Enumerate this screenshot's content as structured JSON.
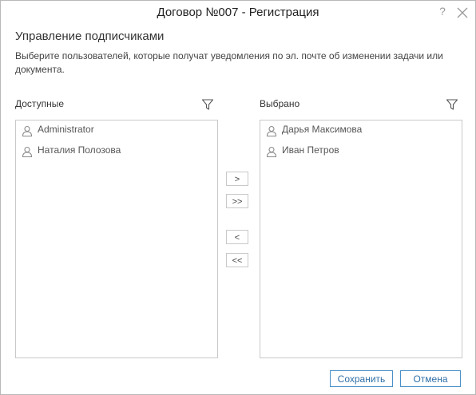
{
  "window": {
    "title": "Договор №007 - Регистрация",
    "help_label": "?"
  },
  "heading": "Управление подписчиками",
  "description": "Выберите пользователей, которые получат уведомления по эл. почте об изменении задачи или документа.",
  "available": {
    "label": "Доступные",
    "items": [
      "Administrator",
      "Наталия Полозова"
    ]
  },
  "selected": {
    "label": "Выбрано",
    "items": [
      "Дарья Максимова",
      "Иван Петров"
    ]
  },
  "move_buttons": {
    "add_one": ">",
    "add_all": ">>",
    "remove_one": "<",
    "remove_all": "<<"
  },
  "actions": {
    "save": "Сохранить",
    "cancel": "Отмена"
  },
  "colors": {
    "accent": "#4a90c8",
    "border": "#c9c9c9",
    "icon": "#8a8a8a"
  },
  "icons": [
    "help-icon",
    "close-icon",
    "filter-icon",
    "user-icon"
  ]
}
